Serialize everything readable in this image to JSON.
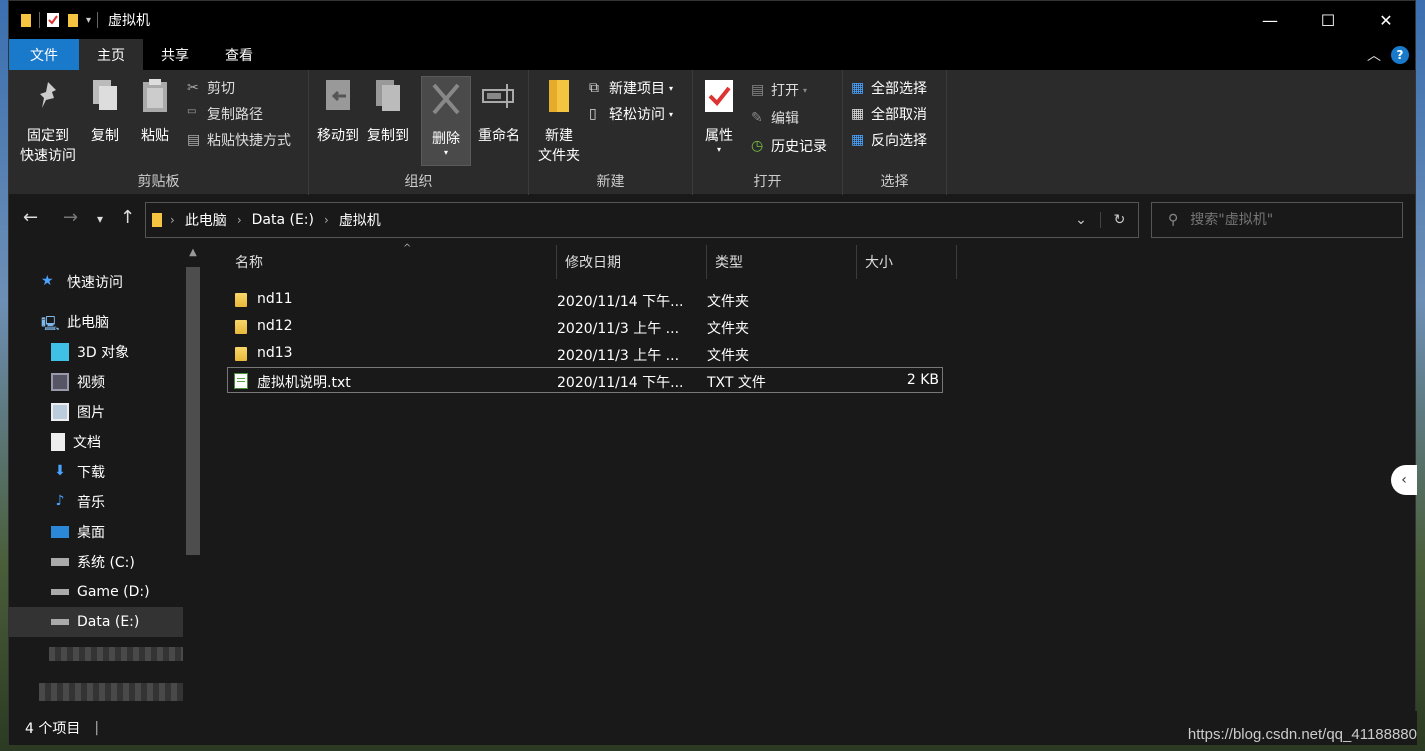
{
  "window": {
    "title": "虚拟机"
  },
  "tabs": [
    {
      "label": "文件"
    },
    {
      "label": "主页"
    },
    {
      "label": "共享"
    },
    {
      "label": "查看"
    }
  ],
  "ribbon": {
    "clipboard": {
      "label": "剪贴板",
      "pin_line1": "固定到",
      "pin_line2": "快速访问",
      "copy": "复制",
      "paste": "粘贴",
      "cut": "剪切",
      "copy_path": "复制路径",
      "paste_shortcut": "粘贴快捷方式"
    },
    "organize": {
      "label": "组织",
      "move_to": "移动到",
      "copy_to": "复制到",
      "delete": "删除",
      "rename": "重命名"
    },
    "new": {
      "label": "新建",
      "new_folder_line1": "新建",
      "new_folder_line2": "文件夹",
      "new_item": "新建项目",
      "easy_access": "轻松访问"
    },
    "open": {
      "label": "打开",
      "properties": "属性",
      "open": "打开",
      "edit": "编辑",
      "history": "历史记录"
    },
    "select": {
      "label": "选择",
      "select_all": "全部选择",
      "select_none": "全部取消",
      "invert": "反向选择"
    }
  },
  "address": {
    "crumbs": [
      "此电脑",
      "Data (E:)",
      "虚拟机"
    ],
    "search_placeholder": "搜索\"虚拟机\""
  },
  "sidebar": {
    "items": [
      {
        "label": "快速访问",
        "icon": "star-icon"
      },
      {
        "label": "此电脑",
        "icon": "computer-icon"
      },
      {
        "label": "3D 对象",
        "icon": "cube-icon"
      },
      {
        "label": "视频",
        "icon": "video-icon"
      },
      {
        "label": "图片",
        "icon": "picture-icon"
      },
      {
        "label": "文档",
        "icon": "document-icon"
      },
      {
        "label": "下载",
        "icon": "download-icon"
      },
      {
        "label": "音乐",
        "icon": "music-icon"
      },
      {
        "label": "桌面",
        "icon": "desktop-icon"
      },
      {
        "label": "系统 (C:)",
        "icon": "drive-icon"
      },
      {
        "label": "Game (D:)",
        "icon": "drive-icon"
      },
      {
        "label": "Data (E:)",
        "icon": "drive-icon"
      }
    ]
  },
  "columns": {
    "name": "名称",
    "modified": "修改日期",
    "type": "类型",
    "size": "大小"
  },
  "files": [
    {
      "name": "nd11",
      "modified": "2020/11/14 下午...",
      "type": "文件夹",
      "size": ""
    },
    {
      "name": "nd12",
      "modified": "2020/11/3 上午 ...",
      "type": "文件夹",
      "size": ""
    },
    {
      "name": "nd13",
      "modified": "2020/11/3 上午 ...",
      "type": "文件夹",
      "size": ""
    },
    {
      "name": "虚拟机说明.txt",
      "modified": "2020/11/14 下午...",
      "type": "TXT 文件",
      "size": "2 KB"
    }
  ],
  "status": {
    "count": "4 个项目"
  },
  "watermark": "https://blog.csdn.net/qq_41188880",
  "colors": {
    "accent": "#1979ca",
    "background": "#191919",
    "ribbon": "#2b2b2b"
  }
}
